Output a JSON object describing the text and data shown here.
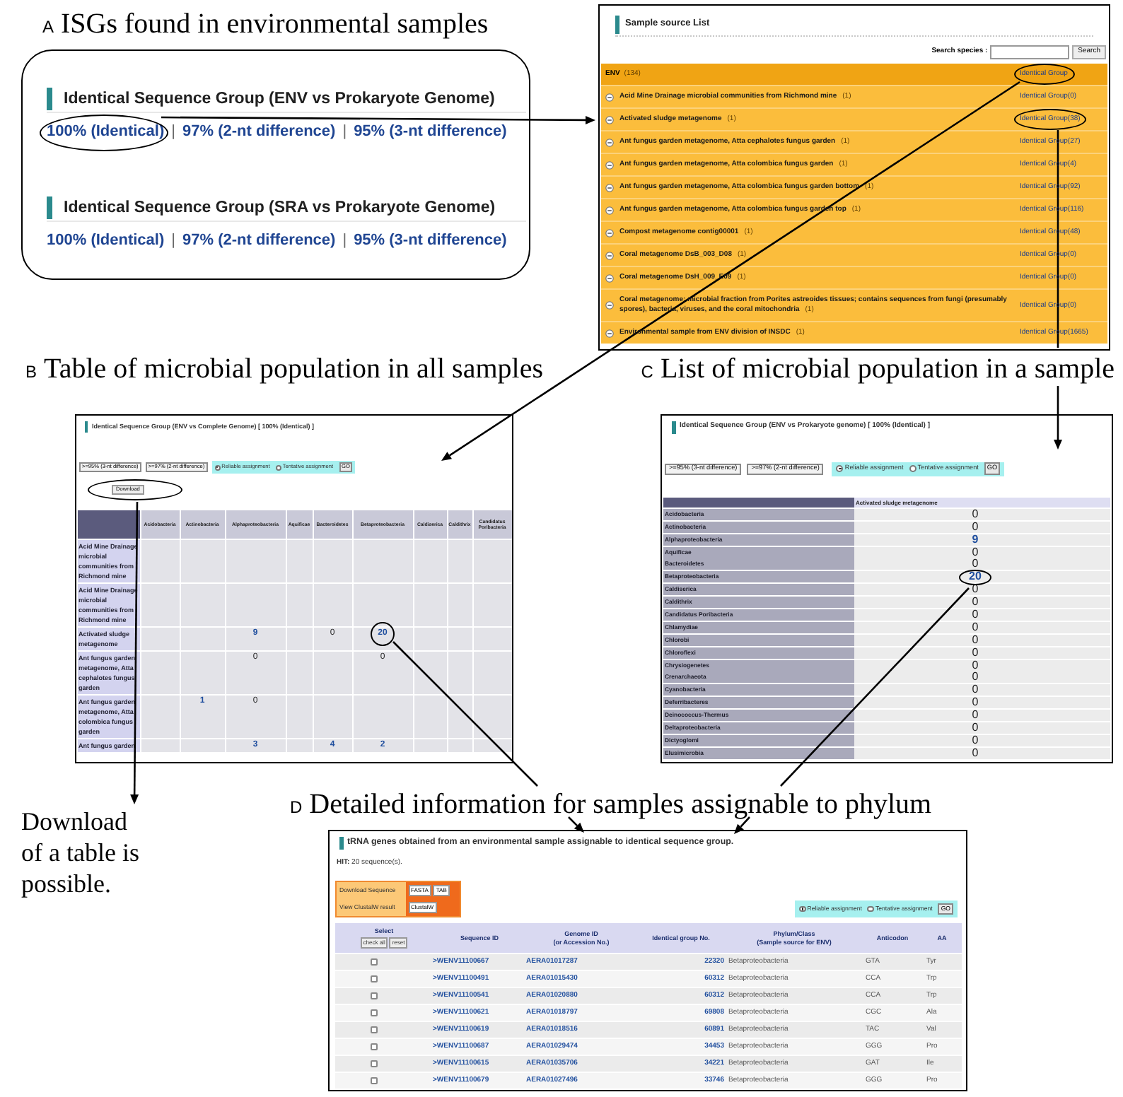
{
  "panel_a": {
    "label": "A",
    "title": "ISGs found in environmental samples",
    "isg_card": {
      "sections": [
        {
          "heading": "Identical Sequence Group (ENV vs Prokaryote Genome)",
          "links": [
            {
              "kind": "link",
              "text": "100% (Identical)",
              "circled": true
            },
            {
              "kind": "separator",
              "text": "|"
            },
            {
              "kind": "link",
              "text": "97% (2-nt difference)",
              "circled": false
            },
            {
              "kind": "separator",
              "text": "|"
            },
            {
              "kind": "link",
              "text": "95% (3-nt difference)",
              "circled": false
            }
          ]
        },
        {
          "heading": "Identical Sequence Group (SRA vs Prokaryote Genome)",
          "links": [
            {
              "kind": "link",
              "text": "100% (Identical)",
              "circled": false
            },
            {
              "kind": "separator",
              "text": "|"
            },
            {
              "kind": "link",
              "text": "97% (2-nt difference)",
              "circled": false
            },
            {
              "kind": "separator",
              "text": "|"
            },
            {
              "kind": "link",
              "text": "95% (3-nt difference)",
              "circled": false
            }
          ]
        }
      ]
    },
    "sample_source_list": {
      "heading": "Sample source List",
      "search": {
        "label": "Search species :",
        "button": "Search"
      },
      "group": {
        "name": "ENV",
        "count": "(134)",
        "link": "Identical Group",
        "circled": true
      },
      "rows": [
        {
          "name": "Acid Mine Drainage microbial communities from Richmond mine",
          "count": "(1)",
          "link": "Identical Group(0)",
          "circled": false
        },
        {
          "name": "Activated sludge metagenome",
          "count": "(1)",
          "link": "Identical Group(38)",
          "circled": true
        },
        {
          "name": "Ant fungus garden metagenome, Atta cephalotes fungus garden",
          "count": "(1)",
          "link": "Identical Group(27)",
          "circled": false
        },
        {
          "name": "Ant fungus garden metagenome, Atta colombica fungus garden",
          "count": "(1)",
          "link": "Identical Group(4)",
          "circled": false
        },
        {
          "name": "Ant fungus garden metagenome, Atta colombica fungus garden bottom",
          "count": "(1)",
          "link": "Identical Group(92)",
          "circled": false
        },
        {
          "name": "Ant fungus garden metagenome, Atta colombica fungus garden top",
          "count": "(1)",
          "link": "Identical Group(116)",
          "circled": false
        },
        {
          "name": "Compost metagenome contig00001",
          "count": "(1)",
          "link": "Identical Group(48)",
          "circled": false
        },
        {
          "name": "Coral metagenome DsB_003_D08",
          "count": "(1)",
          "link": "Identical Group(0)",
          "circled": false
        },
        {
          "name": "Coral metagenome DsH_009_E09",
          "count": "(1)",
          "link": "Identical Group(0)",
          "circled": false
        },
        {
          "name": "Coral metagenome; microbial fraction from Porites astreoides tissues; contains sequences from fungi (presumably spores), bacteria, viruses, and the coral mitochondria",
          "count": "(1)",
          "link": "Identical Group(0)",
          "circled": false
        },
        {
          "name": "Environmental sample from ENV division of INSDC",
          "count": "(1)",
          "link": "Identical Group(1665)",
          "circled": false
        }
      ]
    }
  },
  "panel_b": {
    "label": "B",
    "title": "Table of microbial population in all samples",
    "window": {
      "heading": "Identical Sequence Group (ENV vs Complete Genome) [ 100% (Identical) ]",
      "buttons": [
        ">=95% (3-nt difference)",
        ">=97% (2-nt difference)"
      ],
      "assignment": {
        "options": [
          {
            "label": "Reliable assignment",
            "selected": true
          },
          {
            "label": "Tentative assignment",
            "selected": false
          }
        ],
        "go": "GO"
      },
      "download": {
        "label": "Download",
        "circled": true
      },
      "table": {
        "columns": [
          "Acidobacteria",
          "Actinobacteria",
          "Alphaproteobacteria",
          "Aquificae",
          "Bacteroidetes",
          "Betaproteobacteria",
          "Caldiserica",
          "Caldithrix",
          "Candidatus Poribacteria"
        ],
        "rows": [
          {
            "sample": "Acid Mine Drainage microbial communities from Richmond mine"
          },
          {
            "sample": "Acid Mine Drainage microbial communities from Richmond mine"
          },
          {
            "sample": "Activated sludge metagenome",
            "cells": [
              null,
              null,
              {
                "value": "9",
                "link": true,
                "circled": false
              },
              null,
              {
                "value": "0",
                "link": false,
                "circled": false
              },
              {
                "value": "20",
                "link": true,
                "circled": true
              }
            ]
          },
          {
            "sample": "Ant fungus garden metagenome, Atta cephalotes fungus garden",
            "cells": [
              null,
              null,
              {
                "value": "0",
                "link": false,
                "circled": false
              },
              null,
              null,
              {
                "value": "0",
                "link": false,
                "circled": false
              }
            ]
          },
          {
            "sample": "Ant fungus garden metagenome, Atta colombica fungus garden",
            "cells": [
              null,
              {
                "value": "1",
                "link": true,
                "circled": false
              },
              {
                "value": "0",
                "link": false,
                "circled": false
              }
            ]
          },
          {
            "sample": "Ant fungus garden",
            "cells": [
              null,
              null,
              {
                "value": "3",
                "link": true,
                "circled": false
              },
              null,
              {
                "value": "4",
                "link": true,
                "circled": false
              },
              {
                "value": "2",
                "link": true,
                "circled": false
              }
            ]
          }
        ]
      }
    }
  },
  "panel_c": {
    "label": "C",
    "title": "List of microbial population in a sample",
    "window": {
      "heading": "Identical Sequence Group (ENV vs Prokaryote genome) [ 100% (Identical) ]",
      "buttons": [
        ">=95% (3-nt difference)",
        ">=97% (2-nt difference)"
      ],
      "assignment": {
        "options": [
          {
            "label": "Reliable assignment",
            "selected": true
          },
          {
            "label": "Tentative assignment",
            "selected": false
          }
        ],
        "go": "GO"
      },
      "table": {
        "column": "Activated sludge metagenome",
        "rows": [
          {
            "phylum": "Acidobacteria",
            "value": "0",
            "link": false,
            "circled": false
          },
          {
            "phylum": "Actinobacteria",
            "value": "0",
            "link": false,
            "circled": false
          },
          {
            "phylum": "Alphaproteobacteria",
            "value": "9",
            "link": true,
            "circled": false
          },
          {
            "phylum": "Aquificae",
            "value": "0",
            "link": false,
            "circled": false
          },
          {
            "phylum": "Bacteroidetes",
            "value": "0",
            "link": false,
            "circled": false
          },
          {
            "phylum": "Betaproteobacteria",
            "value": "20",
            "link": true,
            "circled": true
          },
          {
            "phylum": "Caldiserica",
            "value": "0",
            "link": false,
            "circled": false
          },
          {
            "phylum": "Caldithrix",
            "value": "0",
            "link": false,
            "circled": false
          },
          {
            "phylum": "Candidatus Poribacteria",
            "value": "0",
            "link": false,
            "circled": false
          },
          {
            "phylum": "Chlamydiae",
            "value": "0",
            "link": false,
            "circled": false
          },
          {
            "phylum": "Chlorobi",
            "value": "0",
            "link": false,
            "circled": false
          },
          {
            "phylum": "Chloroflexi",
            "value": "0",
            "link": false,
            "circled": false
          },
          {
            "phylum": "Chrysiogenetes",
            "value": "0",
            "link": false,
            "circled": false
          },
          {
            "phylum": "Crenarchaeota",
            "value": "0",
            "link": false,
            "circled": false
          },
          {
            "phylum": "Cyanobacteria",
            "value": "0",
            "link": false,
            "circled": false
          },
          {
            "phylum": "Deferribacteres",
            "value": "0",
            "link": false,
            "circled": false
          },
          {
            "phylum": "Deinococcus-Thermus",
            "value": "0",
            "link": false,
            "circled": false
          },
          {
            "phylum": "Deltaproteobacteria",
            "value": "0",
            "link": false,
            "circled": false
          },
          {
            "phylum": "Dictyoglomi",
            "value": "0",
            "link": false,
            "circled": false
          },
          {
            "phylum": "Elusimicrobia",
            "value": "0",
            "link": false,
            "circled": false
          }
        ]
      }
    }
  },
  "download_note": "Download of a table is possible.",
  "panel_d": {
    "label": "D",
    "title": "Detailed information for samples assignable to phylum",
    "window": {
      "heading": "tRNA genes obtained from an environmental sample assignable to identical sequence group.",
      "hit": "**HIT:** 20 sequence(s).",
      "actions": [
        {
          "label": "Download Sequence",
          "buttons": [
            "FASTA",
            "TAB"
          ]
        },
        {
          "label": "View ClustalW result",
          "buttons": [
            "ClustalW"
          ]
        }
      ],
      "assignment": {
        "options": [
          {
            "label": "Reliable assignment",
            "selected": true
          },
          {
            "label": "Tentative assignment",
            "selected": false
          }
        ],
        "go": "GO"
      },
      "table": {
        "columns": [
          {
            "title": "Select",
            "buttons": [
              "check all",
              "reset"
            ]
          },
          {
            "title": "Sequence ID"
          },
          {
            "title": "Genome ID",
            "subtitle": "(or Accession No.)"
          },
          {
            "title": "Identical group No."
          },
          {
            "title": "Phylum/Class",
            "subtitle": "(Sample source for ENV)"
          },
          {
            "title": "Anticodon"
          },
          {
            "title": "AA"
          }
        ],
        "rows": [
          {
            "checked": false,
            "sequence_id": ">WENV11100667",
            "genome_id": "AERA01017287",
            "group_no": "22320",
            "phylum": "Betaproteobacteria",
            "anticodon": "GTA",
            "aa": "Tyr"
          },
          {
            "checked": false,
            "sequence_id": ">WENV11100491",
            "genome_id": "AERA01015430",
            "group_no": "60312",
            "phylum": "Betaproteobacteria",
            "anticodon": "CCA",
            "aa": "Trp"
          },
          {
            "checked": false,
            "sequence_id": ">WENV11100541",
            "genome_id": "AERA01020880",
            "group_no": "60312",
            "phylum": "Betaproteobacteria",
            "anticodon": "CCA",
            "aa": "Trp"
          },
          {
            "checked": false,
            "sequence_id": ">WENV11100621",
            "genome_id": "AERA01018797",
            "group_no": "69808",
            "phylum": "Betaproteobacteria",
            "anticodon": "CGC",
            "aa": "Ala"
          },
          {
            "checked": false,
            "sequence_id": ">WENV11100619",
            "genome_id": "AERA01018516",
            "group_no": "60891",
            "phylum": "Betaproteobacteria",
            "anticodon": "TAC",
            "aa": "Val"
          },
          {
            "checked": false,
            "sequence_id": ">WENV11100687",
            "genome_id": "AERA01029474",
            "group_no": "34453",
            "phylum": "Betaproteobacteria",
            "anticodon": "GGG",
            "aa": "Pro"
          },
          {
            "checked": false,
            "sequence_id": ">WENV11100615",
            "genome_id": "AERA01035706",
            "group_no": "34221",
            "phylum": "Betaproteobacteria",
            "anticodon": "GAT",
            "aa": "Ile"
          },
          {
            "checked": false,
            "sequence_id": ">WENV11100679",
            "genome_id": "AERA01027496",
            "group_no": "33746",
            "phylum": "Betaproteobacteria",
            "anticodon": "GGG",
            "aa": "Pro"
          }
        ]
      }
    }
  }
}
